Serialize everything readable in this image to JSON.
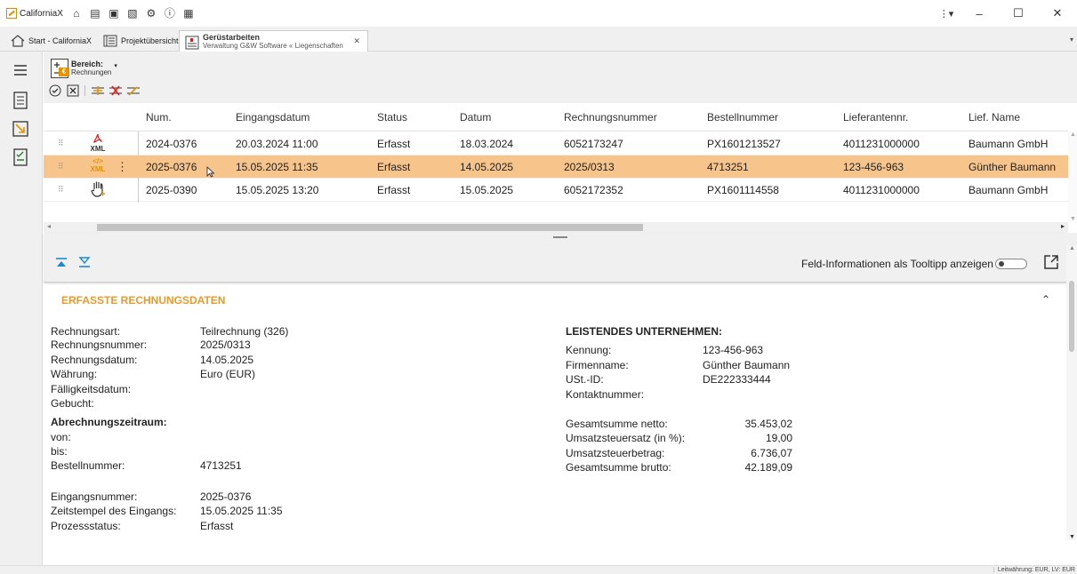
{
  "titlebar": {
    "app_name": "CaliforniaX"
  },
  "tabs": [
    {
      "label": "Start - CaliforniaX"
    },
    {
      "label": "Projektübersicht"
    },
    {
      "title": "Gerüstarbeiten",
      "subtitle": "Verwaltung G&W Software « Liegenschaften"
    }
  ],
  "toolbar": {
    "bereich_label": "Bereich:",
    "bereich_value": "Rechnungen"
  },
  "table": {
    "columns": [
      "Num.",
      "Eingangsdatum",
      "Status",
      "Datum",
      "Rechnungsnummer",
      "Bestellnummer",
      "Lieferantennr.",
      "Lief. Name"
    ],
    "rows": [
      {
        "icon": "pdf-xml-icon",
        "icon_text": "XML",
        "num": "2024-0376",
        "eingangsdatum": "20.03.2024 11:00",
        "status": "Erfasst",
        "datum": "18.03.2024",
        "rechnungsnummer": "6052173247",
        "bestellnummer": "PX1601213527",
        "lieferantennr": "4011231000000",
        "lief_name": "Baumann GmbH"
      },
      {
        "icon": "code-xml-icon",
        "icon_text": "XML",
        "code_text": "</>",
        "num": "2025-0376",
        "eingangsdatum": "15.05.2025 11:35",
        "status": "Erfasst",
        "datum": "14.05.2025",
        "rechnungsnummer": "2025/0313",
        "bestellnummer": "4713251",
        "lieferantennr": "123-456-963",
        "lief_name": "Günther Baumann"
      },
      {
        "icon": "manual-hand-icon",
        "num": "2025-0390",
        "eingangsdatum": "15.05.2025 13:20",
        "status": "Erfasst",
        "datum": "15.05.2025",
        "rechnungsnummer": "6052172352",
        "bestellnummer": "PX1601114558",
        "lieferantennr": "4011231000000",
        "lief_name": "Baumann GmbH"
      }
    ]
  },
  "detail_toolbar": {
    "tooltip_toggle_label": "Feld-Informationen als Tooltipp anzeigen"
  },
  "detail": {
    "section_title": "ERFASSTE RECHNUNGSDATEN",
    "left": {
      "rechnungsart_label": "Rechnungsart:",
      "rechnungsart_value": "Teilrechnung (326)",
      "rechnungsnummer_label": "Rechnungsnummer:",
      "rechnungsnummer_value": "2025/0313",
      "rechnungsdatum_label": "Rechnungsdatum:",
      "rechnungsdatum_value": "14.05.2025",
      "waehrung_label": "Währung:",
      "waehrung_value": "Euro (EUR)",
      "faelligkeitsdatum_label": "Fälligkeitsdatum:",
      "gebucht_label": "Gebucht:",
      "abrechnungszeitraum_label": "Abrechnungszeitraum:",
      "von_label": "von:",
      "bis_label": "bis:",
      "bestellnummer_label": "Bestellnummer:",
      "bestellnummer_value": "4713251",
      "eingangsnummer_label": "Eingangsnummer:",
      "eingangsnummer_value": "2025-0376",
      "zeitstempel_label": "Zeitstempel des Eingangs:",
      "zeitstempel_value": "15.05.2025 11:35",
      "prozessstatus_label": "Prozessstatus:",
      "prozessstatus_value": "Erfasst"
    },
    "right": {
      "heading": "LEISTENDES UNTERNEHMEN:",
      "kennung_label": "Kennung:",
      "kennung_value": "123-456-963",
      "firmenname_label": "Firmenname:",
      "firmenname_value": "Günther Baumann",
      "ustid_label": "USt.-ID:",
      "ustid_value": "DE222333444",
      "kontaktnummer_label": "Kontaktnummer:",
      "netto_label": "Gesamtsumme netto:",
      "netto_value": "35.453,02",
      "steuersatz_label": "Umsatzsteuersatz (in %):",
      "steuersatz_value": "19,00",
      "steuerbetrag_label": "Umsatzsteuerbetrag:",
      "steuerbetrag_value": "6.736,07",
      "brutto_label": "Gesamtsumme brutto:",
      "brutto_value": "42.189,09"
    }
  },
  "statusbar": {
    "text": "Leitwährung: EUR, LV: EUR"
  },
  "colors": {
    "accent": "#e89a2c",
    "selected_row": "#f7c58c",
    "nav_blue": "#1b8ad6"
  }
}
